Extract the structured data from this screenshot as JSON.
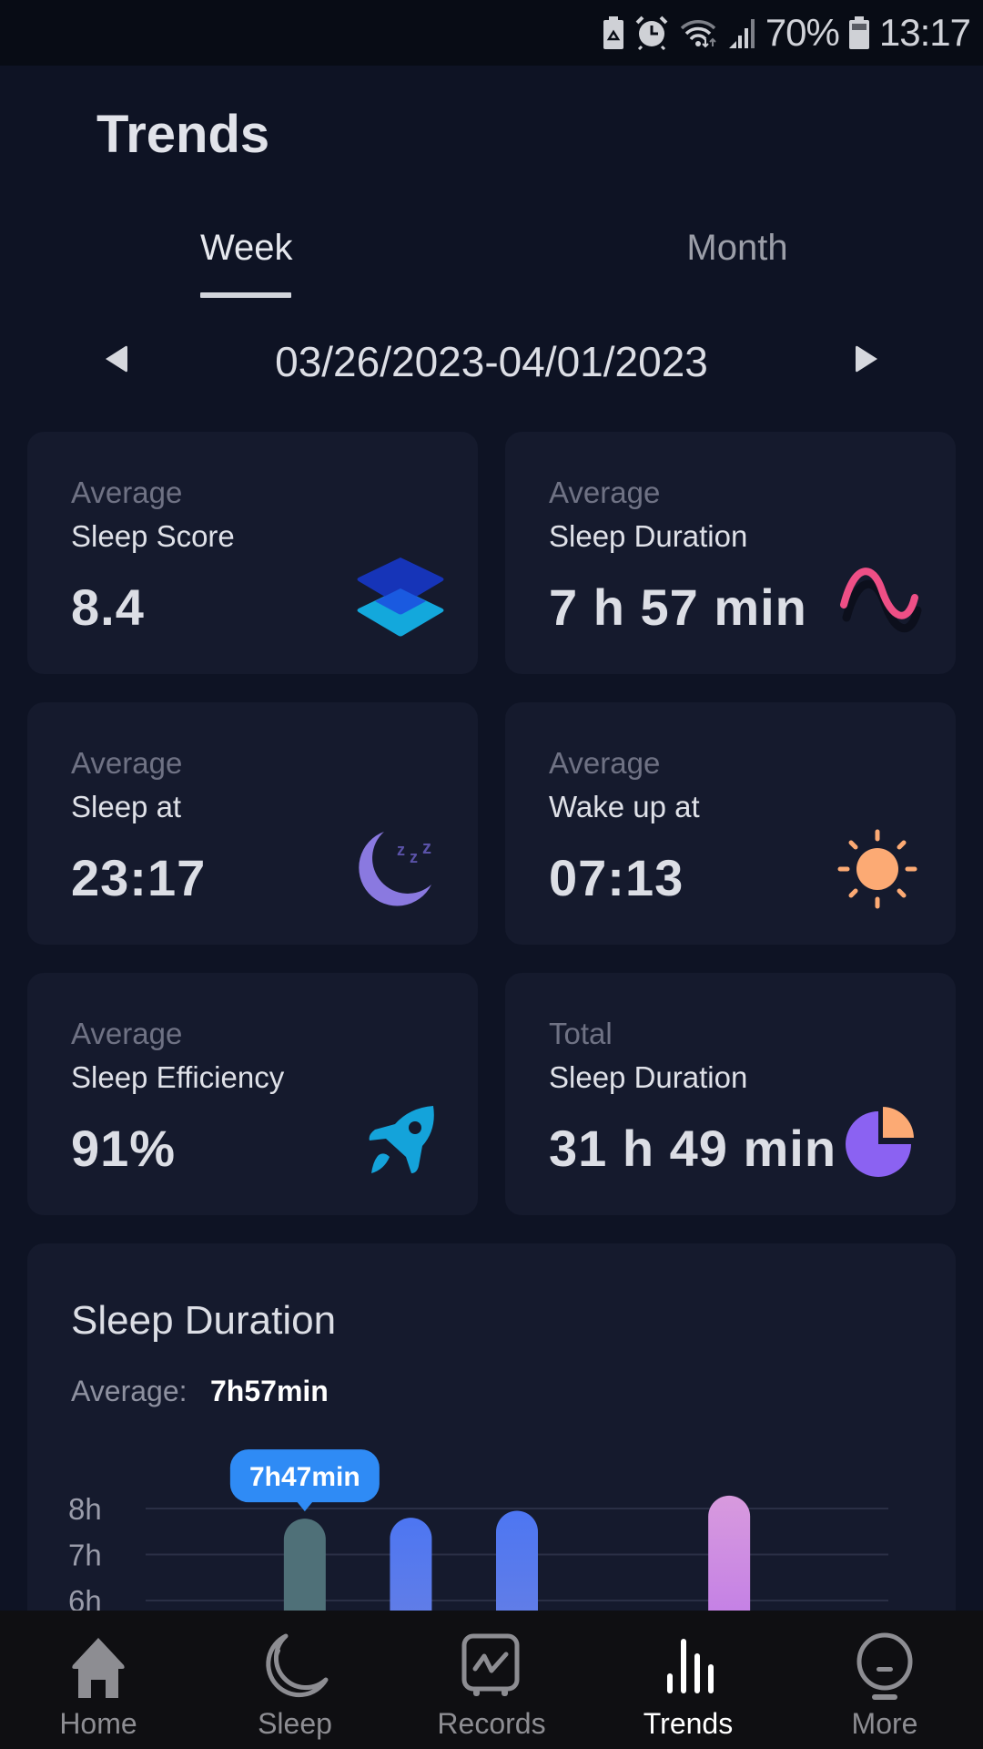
{
  "status_bar": {
    "battery_percent": "70%",
    "time": "13:17",
    "icons": [
      "battery-saver-icon",
      "alarm-icon",
      "wifi-icon",
      "signal-icon",
      "battery-icon"
    ]
  },
  "header": {
    "title": "Trends"
  },
  "tabs": [
    {
      "label": "Week",
      "active": true
    },
    {
      "label": "Month",
      "active": false
    }
  ],
  "date_nav": {
    "range": "03/26/2023-04/01/2023",
    "prev_icon": "triangle-left-icon",
    "next_icon": "triangle-right-icon"
  },
  "stats": [
    {
      "qualifier": "Average",
      "label": "Sleep Score",
      "value": "8.4",
      "icon": "layers-icon"
    },
    {
      "qualifier": "Average",
      "label": "Sleep Duration",
      "value": "7 h 57 min",
      "icon": "sine-wave-icon"
    },
    {
      "qualifier": "Average",
      "label": "Sleep at",
      "value": "23:17",
      "icon": "moon-zzz-icon"
    },
    {
      "qualifier": "Average",
      "label": "Wake up at",
      "value": "07:13",
      "icon": "sun-icon"
    },
    {
      "qualifier": "Average",
      "label": "Sleep Efficiency",
      "value": "91%",
      "icon": "rocket-icon"
    },
    {
      "qualifier": "Total",
      "label": "Sleep Duration",
      "value": "31 h 49 min",
      "icon": "pie-chart-icon"
    }
  ],
  "colors": {
    "accent_blue": "#2f8bf5",
    "bar_default": "#5579f0",
    "bar_selected": "#4f7078",
    "bar_highlight": "#cf8de2",
    "sine_pink": "#ee4f86",
    "moon_purple": "#8a79e0",
    "sun_orange": "#fcaa74",
    "rocket_blue": "#14a3da",
    "pie_purple": "#8b62f2",
    "pie_orange": "#fcaa74"
  },
  "sleep_duration_card": {
    "title": "Sleep Duration",
    "average_label": "Average:",
    "average_value": "7h57min",
    "tooltip": "7h47min",
    "selected_index": 1
  },
  "chart_data": {
    "type": "bar",
    "title": "Sleep Duration",
    "xlabel": "",
    "ylabel": "",
    "categories": [
      "",
      "",
      "",
      "",
      "",
      "",
      ""
    ],
    "values": [
      null,
      7.78,
      7.8,
      7.95,
      null,
      8.28,
      null
    ],
    "value_unit": "hours",
    "bar_styles": [
      null,
      "selected",
      "default",
      "default",
      null,
      "highlight",
      null
    ],
    "yticks": [
      "6h",
      "7h",
      "8h"
    ],
    "ytick_values": [
      6,
      7,
      8
    ],
    "ylim_visible": [
      5.8,
      8.6
    ],
    "grid": true,
    "annotation": {
      "index": 1,
      "text": "7h47min"
    }
  },
  "nav": [
    {
      "label": "Home",
      "icon": "home-icon",
      "active": false
    },
    {
      "label": "Sleep",
      "icon": "moon-icon",
      "active": false
    },
    {
      "label": "Records",
      "icon": "records-icon",
      "active": false
    },
    {
      "label": "Trends",
      "icon": "bar-chart-icon",
      "active": true
    },
    {
      "label": "More",
      "icon": "device-icon",
      "active": false
    }
  ]
}
